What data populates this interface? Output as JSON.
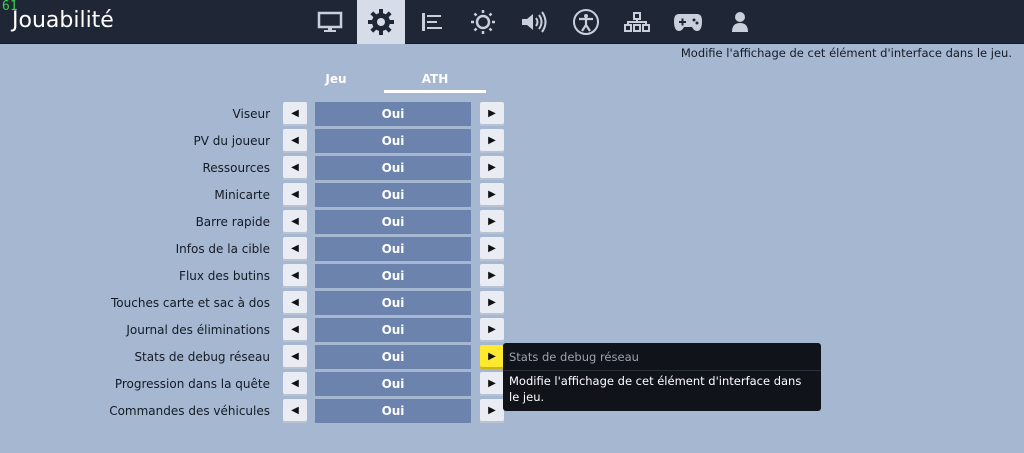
{
  "overlay": {
    "fps": "61"
  },
  "header": {
    "title": "Jouabilité",
    "tabs": [
      {
        "icon": "monitor-icon",
        "active": false
      },
      {
        "icon": "gear-icon",
        "active": true
      },
      {
        "icon": "bars-icon",
        "active": false
      },
      {
        "icon": "brightness-icon",
        "active": false
      },
      {
        "icon": "speaker-icon",
        "active": false
      },
      {
        "icon": "accessibility-icon",
        "active": false
      },
      {
        "icon": "network-icon",
        "active": false
      },
      {
        "icon": "gamepad-icon",
        "active": false
      },
      {
        "icon": "account-icon",
        "active": false
      }
    ]
  },
  "description": "Modifie l'affichage de cet élément d'interface dans le jeu.",
  "subtabs": [
    {
      "label": "Jeu",
      "active": false
    },
    {
      "label": "ATH",
      "active": true
    }
  ],
  "settings": [
    {
      "label": "Viseur",
      "value": "Oui"
    },
    {
      "label": "PV du joueur",
      "value": "Oui"
    },
    {
      "label": "Ressources",
      "value": "Oui"
    },
    {
      "label": "Minicarte",
      "value": "Oui"
    },
    {
      "label": "Barre rapide",
      "value": "Oui"
    },
    {
      "label": "Infos de la cible",
      "value": "Oui"
    },
    {
      "label": "Flux des butins",
      "value": "Oui"
    },
    {
      "label": "Touches carte et sac à dos",
      "value": "Oui"
    },
    {
      "label": "Journal des éliminations",
      "value": "Oui"
    },
    {
      "label": "Stats de debug réseau",
      "value": "Oui"
    },
    {
      "label": "Progression dans la quête",
      "value": "Oui"
    },
    {
      "label": "Commandes des véhicules",
      "value": "Oui"
    }
  ],
  "arrows": {
    "left": "◀",
    "right": "▶"
  },
  "tooltip": {
    "title": "Stats de debug réseau",
    "body": "Modifie l'affichage de cet élément d'interface dans le jeu."
  },
  "colors": {
    "background": "#a6b7d1",
    "header": "#1f2737",
    "value_box": "#6b83ad",
    "highlight": "#ffe92f",
    "fps": "#3bd04a"
  }
}
